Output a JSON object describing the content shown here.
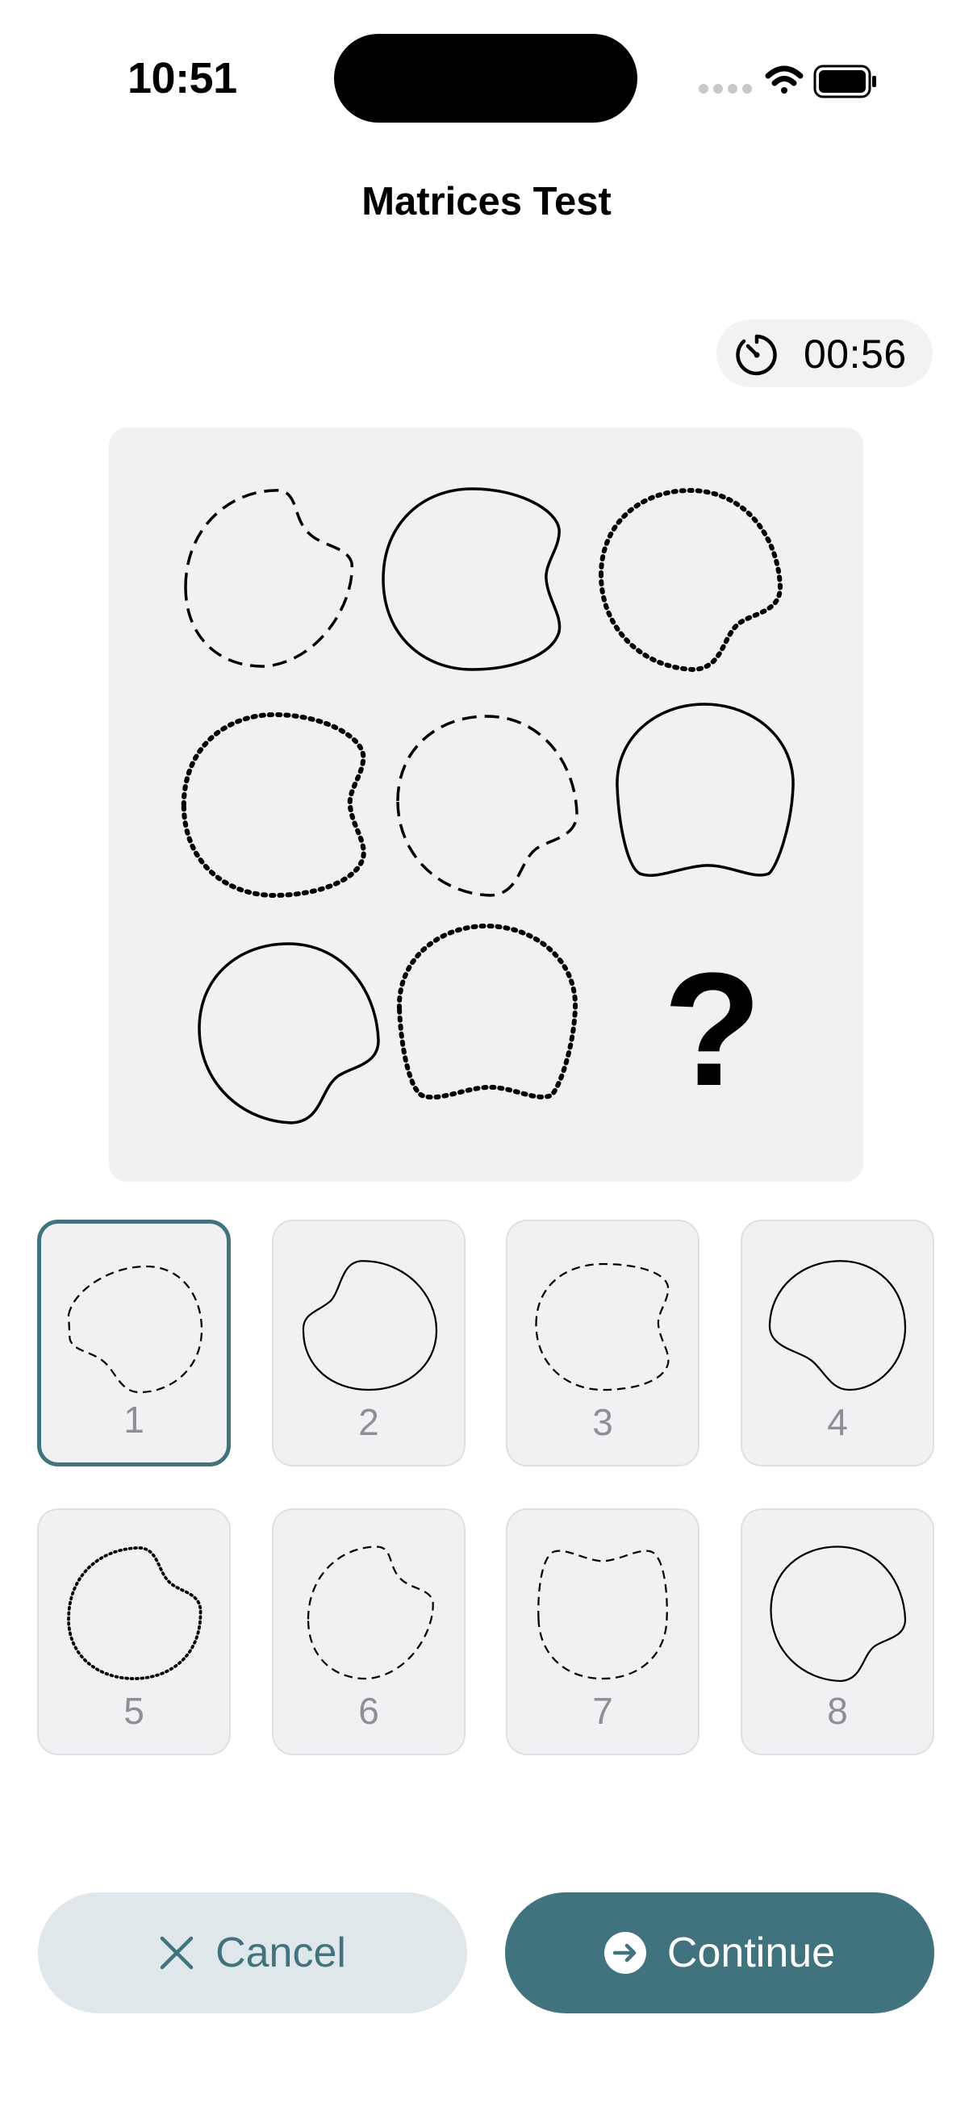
{
  "status_bar": {
    "time": "10:51"
  },
  "header": {
    "title": "Matrices Test"
  },
  "timer": {
    "value": "00:56",
    "icon": "timer-icon"
  },
  "matrix": {
    "missing_cell_label": "?"
  },
  "options": [
    {
      "number": "1",
      "selected": true
    },
    {
      "number": "2",
      "selected": false
    },
    {
      "number": "3",
      "selected": false
    },
    {
      "number": "4",
      "selected": false
    },
    {
      "number": "5",
      "selected": false
    },
    {
      "number": "6",
      "selected": false
    },
    {
      "number": "7",
      "selected": false
    },
    {
      "number": "8",
      "selected": false
    }
  ],
  "buttons": {
    "cancel_label": "Cancel",
    "continue_label": "Continue",
    "cancel_icon": "close-icon",
    "continue_icon": "arrow-right-circle-icon"
  },
  "colors": {
    "accent": "#41737f",
    "cancel_bg": "#dfe7ea",
    "panel_bg": "#f1f1f4"
  }
}
